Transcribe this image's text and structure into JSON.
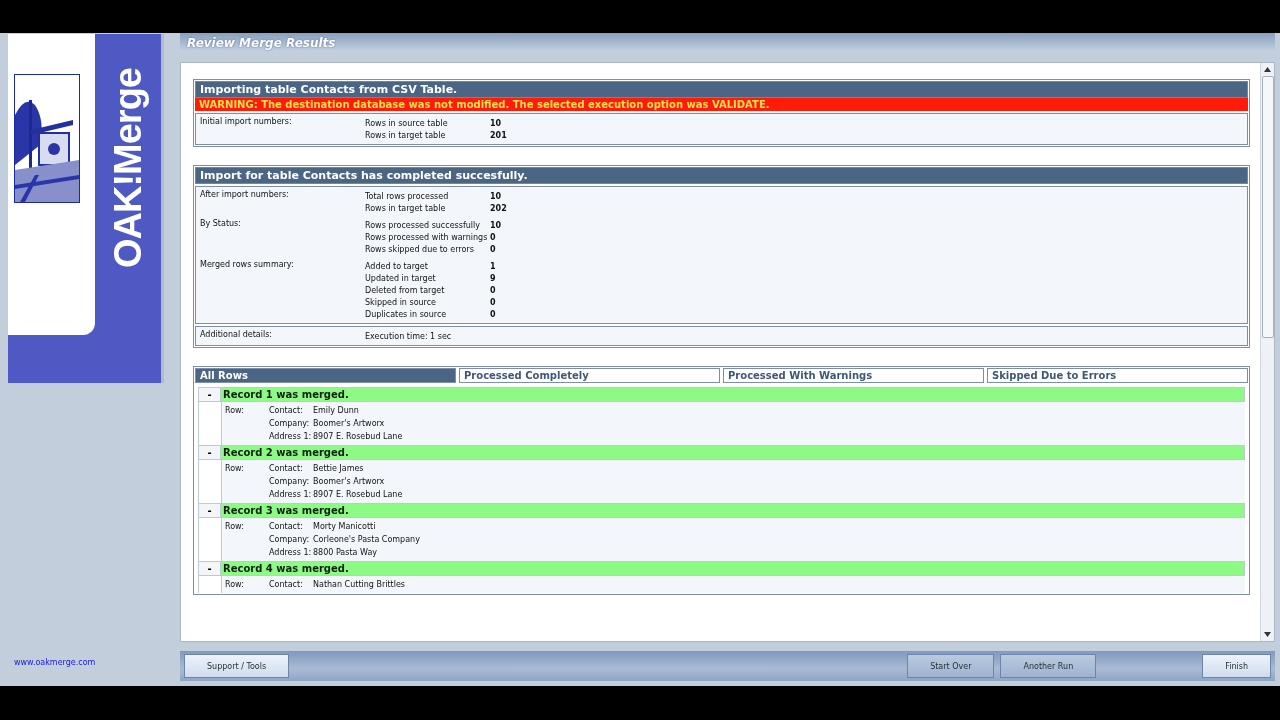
{
  "sidebar": {
    "logo_text": "OAK!Merge",
    "link": "www.oakmerge.com"
  },
  "header": {
    "title": "Review Merge Results"
  },
  "sections": [
    {
      "title": "Importing table Contacts from CSV Table.",
      "warning": "WARNING: The destination database was not modified. The selected execution option was VALIDATE.",
      "groups": [
        {
          "label": "Initial import numbers:",
          "items": [
            {
              "name": "Rows in source table",
              "value": "10"
            },
            {
              "name": "Rows in target table",
              "value": "201"
            }
          ]
        }
      ]
    },
    {
      "title": "Import for table Contacts has completed succesfully.",
      "groups": [
        {
          "label": "After import numbers:",
          "items": [
            {
              "name": "Total rows processed",
              "value": "10"
            },
            {
              "name": "Rows in target table",
              "value": "202"
            }
          ]
        },
        {
          "label": "By Status:",
          "items": [
            {
              "name": "Rows processed successfully",
              "value": "10"
            },
            {
              "name": "Rows processed with warnings",
              "value": "0"
            },
            {
              "name": "Rows skipped due to errors",
              "value": "0"
            }
          ]
        },
        {
          "label": "Merged rows summary:",
          "items": [
            {
              "name": "Added to target",
              "value": "1"
            },
            {
              "name": "Updated in target",
              "value": "9"
            },
            {
              "name": "Deleted from target",
              "value": "0"
            },
            {
              "name": "Skipped in source",
              "value": "0"
            },
            {
              "name": "Duplicates in source",
              "value": "0"
            }
          ]
        }
      ],
      "details": {
        "label": "Additional details:",
        "text": "Execution time: 1 sec"
      }
    }
  ],
  "tabs": [
    {
      "label": "All Rows",
      "selected": true
    },
    {
      "label": "Processed Completely",
      "selected": false
    },
    {
      "label": "Processed With Warnings",
      "selected": false
    },
    {
      "label": "Skipped Due to Errors",
      "selected": false
    }
  ],
  "records": [
    {
      "toggle": "-",
      "title": "Record 1 was merged.",
      "row_label": "Row:",
      "fields": [
        {
          "name": "Contact:",
          "value": "Emily Dunn"
        },
        {
          "name": "Company:",
          "value": "Boomer's Artworx"
        },
        {
          "name": "Address 1:",
          "value": "8907 E. Rosebud Lane"
        }
      ]
    },
    {
      "toggle": "-",
      "title": "Record 2 was merged.",
      "row_label": "Row:",
      "fields": [
        {
          "name": "Contact:",
          "value": "Bettie James"
        },
        {
          "name": "Company:",
          "value": "Boomer's Artworx"
        },
        {
          "name": "Address 1:",
          "value": "8907 E. Rosebud Lane"
        }
      ]
    },
    {
      "toggle": "-",
      "title": "Record 3 was merged.",
      "row_label": "Row:",
      "fields": [
        {
          "name": "Contact:",
          "value": "Morty Manicotti"
        },
        {
          "name": "Company:",
          "value": "Corleone's Pasta Company"
        },
        {
          "name": "Address 1:",
          "value": "8800 Pasta Way"
        }
      ]
    },
    {
      "toggle": "-",
      "title": "Record 4 was merged.",
      "row_label": "Row:",
      "fields": [
        {
          "name": "Contact:",
          "value": "Nathan Cutting Brittles"
        }
      ]
    }
  ],
  "footer": {
    "left_buttons": [
      {
        "label": "Support / Tools",
        "highlighted": true
      }
    ],
    "right_buttons": [
      {
        "label": "Start Over",
        "highlighted": false
      },
      {
        "label": "Another Run",
        "highlighted": false
      },
      {
        "label": "Finish",
        "highlighted": true
      }
    ]
  }
}
